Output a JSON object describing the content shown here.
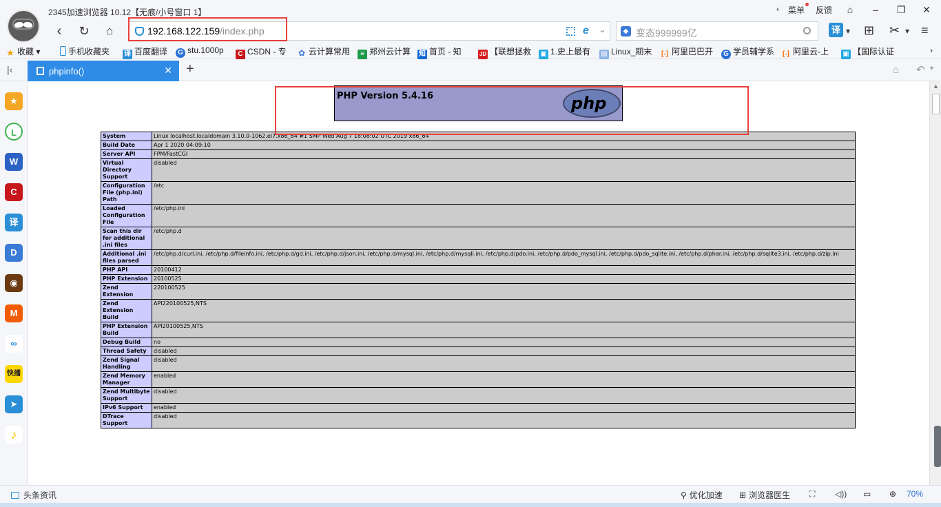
{
  "window": {
    "title": "2345加速浏览器 10.12【无痕/小号窗口 1】",
    "menu_label": "菜单",
    "feedback_label": "反馈"
  },
  "nav": {
    "url_host": "192.168.122.159",
    "url_path": "/index.php",
    "search_text": "变态999999亿",
    "translate_label": "译"
  },
  "bookmarks": [
    {
      "label": "收藏",
      "icon": "star-icon"
    },
    {
      "label": "手机收藏夹",
      "icon": "phone-icon"
    },
    {
      "label": "百度翻译",
      "icon": "translate-icon"
    },
    {
      "label": "stu.1000p",
      "icon": "refresh-site-icon"
    },
    {
      "label": "CSDN - 专",
      "icon": "csdn-icon"
    },
    {
      "label": "云计算常用",
      "icon": "paw-icon"
    },
    {
      "label": "郑州云计算",
      "icon": "sheet-icon"
    },
    {
      "label": "首页 - 知",
      "icon": "zhihu-icon"
    },
    {
      "label": "【联想拯救",
      "icon": "jd-icon"
    },
    {
      "label": "1.史上最有",
      "icon": "bilibili-icon"
    },
    {
      "label": "Linux_期末",
      "icon": "doc-icon"
    },
    {
      "label": "阿里巴巴开",
      "icon": "aliyun-icon"
    },
    {
      "label": "学员辅学系",
      "icon": "refresh-site-icon"
    },
    {
      "label": "阿里云-上",
      "icon": "aliyun-icon"
    },
    {
      "label": "【国际认证",
      "icon": "bilibili-icon"
    }
  ],
  "tab": {
    "label": "phpinfo()"
  },
  "php": {
    "version_title": "PHP Version 5.4.16",
    "logo_text": "php",
    "rows": [
      {
        "key": "System",
        "value": "Linux localhost.localdomain 3.10.0-1062.el7.x86_64 #1 SMP Wed Aug 7 18:08:02 UTC 2019 x86_64"
      },
      {
        "key": "Build Date",
        "value": "Apr 1 2020 04:09:10"
      },
      {
        "key": "Server API",
        "value": "FPM/FastCGI"
      },
      {
        "key": "Virtual Directory Support",
        "value": "disabled"
      },
      {
        "key": "Configuration File (php.ini) Path",
        "value": "/etc"
      },
      {
        "key": "Loaded Configuration File",
        "value": "/etc/php.ini"
      },
      {
        "key": "Scan this dir for additional .ini files",
        "value": "/etc/php.d"
      },
      {
        "key": "Additional .ini files parsed",
        "value": "/etc/php.d/curl.ini, /etc/php.d/fileinfo.ini, /etc/php.d/gd.ini, /etc/php.d/json.ini, /etc/php.d/mysql.ini, /etc/php.d/mysqli.ini, /etc/php.d/pdo.ini, /etc/php.d/pdo_mysql.ini, /etc/php.d/pdo_sqlite.ini, /etc/php.d/phar.ini, /etc/php.d/sqlite3.ini, /etc/php.d/zip.ini"
      },
      {
        "key": "PHP API",
        "value": "20100412"
      },
      {
        "key": "PHP Extension",
        "value": "20100525"
      },
      {
        "key": "Zend Extension",
        "value": "220100525"
      },
      {
        "key": "Zend Extension Build",
        "value": "API220100525,NTS"
      },
      {
        "key": "PHP Extension Build",
        "value": "API20100525,NTS"
      },
      {
        "key": "Debug Build",
        "value": "no"
      },
      {
        "key": "Thread Safety",
        "value": "disabled"
      },
      {
        "key": "Zend Signal Handling",
        "value": "disabled"
      },
      {
        "key": "Zend Memory Manager",
        "value": "enabled"
      },
      {
        "key": "Zend Multibyte Support",
        "value": "disabled"
      },
      {
        "key": "IPv6 Support",
        "value": "enabled"
      },
      {
        "key": "DTrace Support",
        "value": "disabled"
      }
    ]
  },
  "status": {
    "news_label": "头条资讯",
    "speedup_label": "优化加速",
    "doctor_label": "浏览器医生",
    "zoom": "70%"
  },
  "colors": {
    "accent": "#2e8be6",
    "highlight": "#e8403c",
    "php_header": "#9999cc",
    "php_key_cell": "#ccccff",
    "php_value_cell": "#cccccc"
  }
}
